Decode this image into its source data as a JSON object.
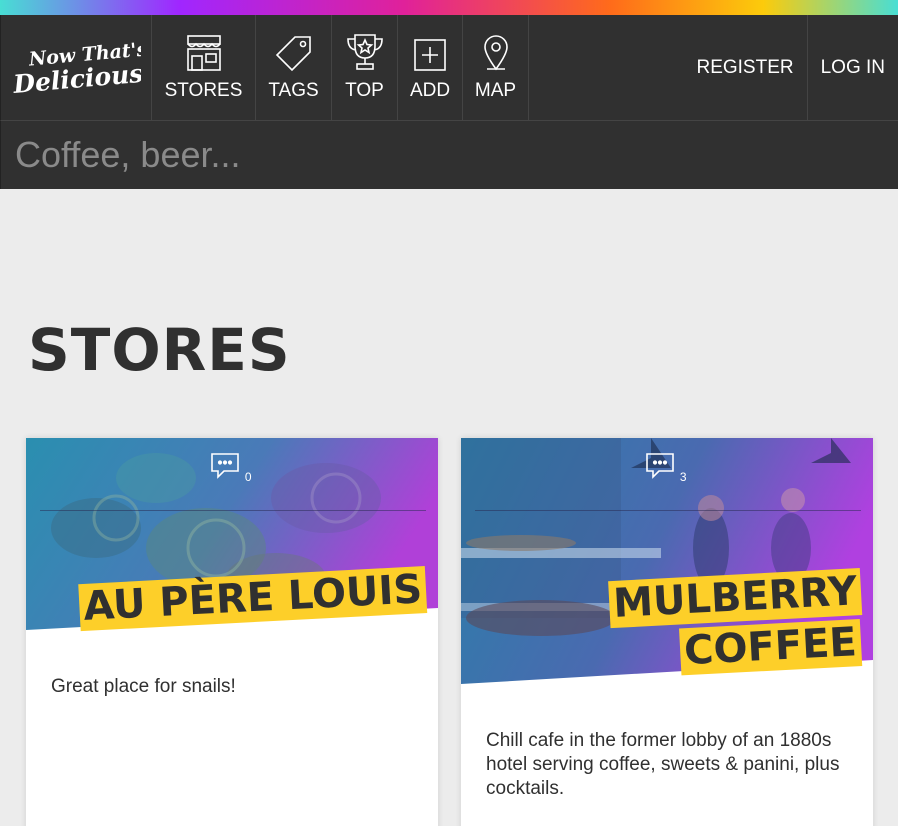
{
  "brand": {
    "logo_text": "Now That's Delicious!"
  },
  "nav": {
    "items": [
      {
        "label": "STORES",
        "icon": "store-icon"
      },
      {
        "label": "TAGS",
        "icon": "tag-icon"
      },
      {
        "label": "TOP",
        "icon": "trophy-icon"
      },
      {
        "label": "ADD",
        "icon": "add-icon"
      },
      {
        "label": "MAP",
        "icon": "map-pin-icon"
      }
    ],
    "register": "REGISTER",
    "login": "LOG IN"
  },
  "search": {
    "placeholder": "Coffee, beer..."
  },
  "page": {
    "title": "STORES"
  },
  "stores": [
    {
      "name_lines": [
        "AU PÈRE LOUIS"
      ],
      "comments": "0",
      "description": "Great place for snails!"
    },
    {
      "name_lines": [
        "MULBERRY",
        "COFFEE"
      ],
      "comments": "3",
      "description": "Chill cafe in the former lobby of an 1880s hotel serving coffee, sweets & panini, plus cocktails."
    }
  ],
  "colors": {
    "nav_bg": "#303030",
    "page_bg": "#ececec",
    "title_highlight": "#fdcf29",
    "text": "#303030"
  }
}
